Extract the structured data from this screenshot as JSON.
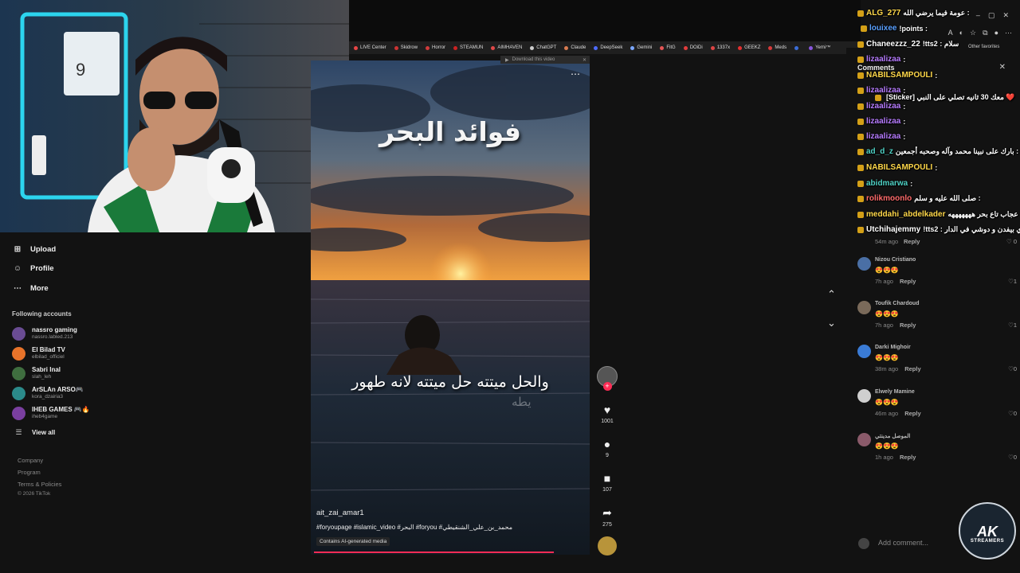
{
  "browser": {
    "bookmarks": [
      {
        "label": "LIVE Center",
        "color": "#e84545"
      },
      {
        "label": "Skidrow",
        "color": "#cc3333"
      },
      {
        "label": "Horror",
        "color": "#d13b3b"
      },
      {
        "label": "STEAMUN",
        "color": "#cc2222"
      },
      {
        "label": "AIMHAVEN",
        "color": "#e04848"
      },
      {
        "label": "ChatGPT",
        "color": "#cccccc"
      },
      {
        "label": "Claude",
        "color": "#d97b50"
      },
      {
        "label": "DeepSeek",
        "color": "#4d6bfe"
      },
      {
        "label": "Gemini",
        "color": "#7aa7ff"
      },
      {
        "label": "FitG",
        "color": "#e55555"
      },
      {
        "label": "DOiDi",
        "color": "#e33c3c"
      },
      {
        "label": "1337x",
        "color": "#d44"
      },
      {
        "label": "GEEKZ",
        "color": "#e53030"
      },
      {
        "label": "Meds",
        "color": "#d83a3a"
      },
      {
        "label": "",
        "color": "#3b6dd8"
      },
      {
        "label": "Yemi™",
        "color": "#8855dd"
      }
    ],
    "other_favorites": "Other favorites"
  },
  "sidebar": {
    "nav": [
      {
        "label": "Upload",
        "icon": "plus-square-icon"
      },
      {
        "label": "Profile",
        "icon": "user-icon"
      },
      {
        "label": "More",
        "icon": "ellipsis-icon"
      }
    ],
    "following_title": "Following accounts",
    "accounts": [
      {
        "name": "nassro gaming",
        "handle": "nassro.labled.213",
        "color": "#6a4c93"
      },
      {
        "name": "El Bilad TV",
        "handle": "elbilad_officiel",
        "color": "#e8732a"
      },
      {
        "name": "Sabri Inal",
        "handle": "slah_leh",
        "color": "#3f6e3f"
      },
      {
        "name": "ArSLAn ARSO🎮",
        "handle": "kora_dzairia3",
        "color": "#2b8a8a"
      },
      {
        "name": "IHEB GAMES 🎮🔥",
        "handle": "iheb4game",
        "color": "#7a3fa0"
      }
    ],
    "view_all": "View all",
    "footer": [
      "Company",
      "Program",
      "Terms & Policies",
      "© 2026 TikTok"
    ]
  },
  "video": {
    "title_overlay": "فوائد البحر",
    "caption_overlay": "والحل ميتته حل ميتته لانه طهور",
    "caption_ghost": "يطه",
    "author": "ait_zai_amar1",
    "tags": "#foryoupage #islamic_video #البحر #foryou #محمد_بن_علي_الشنقيطي",
    "ai_label": "Contains AI-generated media",
    "download_label": "Download this video",
    "progress": 0.86
  },
  "actions": {
    "likes": "1001",
    "comments": "9",
    "saves": "107",
    "shares": "275"
  },
  "comments_panel": {
    "title": "Comments",
    "add_placeholder": "Add comment...",
    "items": [
      {
        "user": "Nizou Cristiano",
        "text": "😍😍😍",
        "time": "7h ago",
        "reply": "Reply",
        "likes": "1",
        "avatar": "#4a6fa5"
      },
      {
        "user": "Toufik Chardoud",
        "text": "😍😍😍",
        "time": "7h ago",
        "reply": "Reply",
        "likes": "1",
        "avatar": "#7a6a5a"
      },
      {
        "user": "Darki Mighoir",
        "text": "😍😍😍",
        "time": "38m ago",
        "reply": "Reply",
        "likes": "0",
        "avatar": "#3a7bd5"
      },
      {
        "user": "Elwely Mamine",
        "text": "😍😍😍",
        "time": "46m ago",
        "reply": "Reply",
        "likes": "0",
        "avatar": "#cfcfcf"
      },
      {
        "user": "الموصل مدينتي",
        "text": "😍😍😍",
        "time": "1h ago",
        "reply": "Reply",
        "likes": "0",
        "avatar": "#8a5a6a"
      }
    ],
    "partial_meta": {
      "time": "54m ago",
      "reply": "Reply",
      "likes": "0"
    }
  },
  "chat": [
    {
      "user": "ALG_277",
      "msg": "عومة فيما يرضي الله :",
      "color": "#ffd84a"
    },
    {
      "user": "louixee",
      "msg": "!points :",
      "color": "#5aa0ff"
    },
    {
      "user": "Chaneezzz_22",
      "msg": "!tts2 : سلام",
      "color": "#ffffff"
    },
    {
      "user": "lizaalizaa",
      "msg": ":",
      "color": "#b77cff"
    },
    {
      "user": "NABILSAMPOULI",
      "msg": ":",
      "color": "#ffd84a"
    },
    {
      "user": "lizaalizaa",
      "msg": ":",
      "color": "#b77cff"
    },
    {
      "user": "",
      "msg": "[Sticker] معك 30 ثانيه تصلي على النبي ❤️",
      "color": "#ffffff"
    },
    {
      "user": "lizaalizaa",
      "msg": ":",
      "color": "#b77cff"
    },
    {
      "user": "lizaalizaa",
      "msg": ":",
      "color": "#b77cff"
    },
    {
      "user": "lizaalizaa",
      "msg": ":",
      "color": "#b77cff"
    },
    {
      "user": "ad_d_z",
      "msg": "بارك على نبينا محمد وآله وصحبه أجمعين :",
      "color": "#4fd1c5"
    },
    {
      "user": "NABILSAMPOULI",
      "msg": ":",
      "color": "#ffd84a"
    },
    {
      "user": "abidmarwa",
      "msg": ":",
      "color": "#4fd1c5"
    },
    {
      "user": "rolikmoonlo",
      "msg": "صلى الله عليه و سلم :",
      "color": "#ff6b6b"
    },
    {
      "user": "meddahi_abdelkader",
      "msg": "عجاب تاع بحر هههههههه :",
      "color": "#ffd84a"
    },
    {
      "user": "Utchihajemmy",
      "msg": "!tts2 : ي بيفدن و دوشي في الدار",
      "color": "#ffffff"
    }
  ],
  "logo": {
    "line1": "AK",
    "line2": "STREAMERS"
  }
}
